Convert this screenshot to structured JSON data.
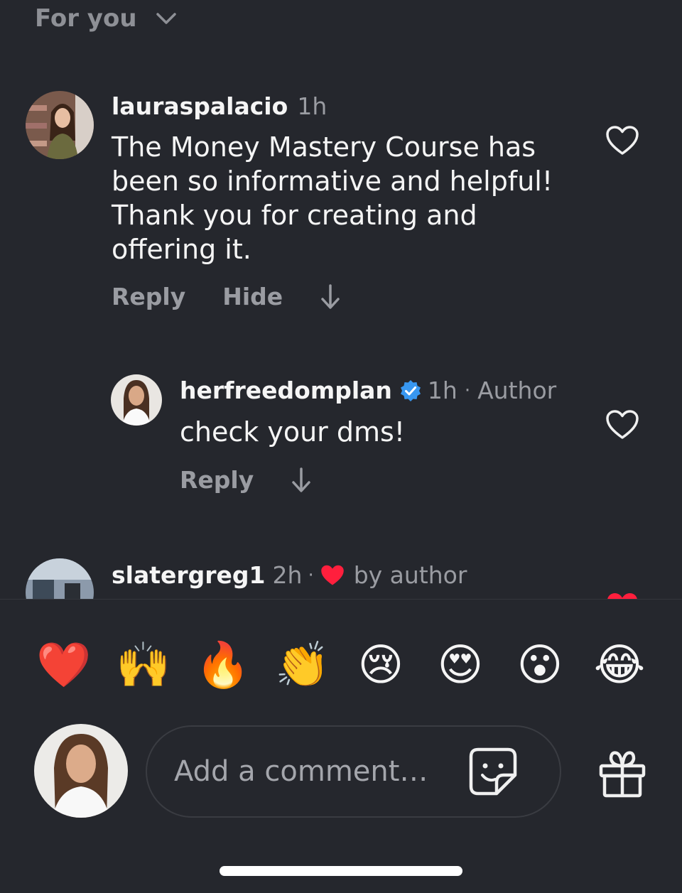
{
  "header": {
    "sort_label": "For you"
  },
  "comments": [
    {
      "username": "lauraspalacio",
      "time": "1h",
      "text": "The Money Mastery Course has been so informative and helpful! Thank you  for creating and offering it.",
      "reply_label": "Reply",
      "hide_label": "Hide"
    },
    {
      "username": "herfreedomplan",
      "verified": true,
      "time": "1h",
      "separator": "·",
      "author_label": "Author",
      "text": "check your dms!",
      "reply_label": "Reply"
    },
    {
      "username": "slatergreg1",
      "time": "2h",
      "separator": "·",
      "liked_by": "by author"
    }
  ],
  "reactions": [
    "❤️",
    "🙌",
    "🔥",
    "👏",
    "😢",
    "😍",
    "😮",
    "😂"
  ],
  "composer": {
    "placeholder": "Add a comment…"
  },
  "colors": {
    "background": "#25272d",
    "heart_red": "#ff1f3d",
    "verified_blue": "#3897f0"
  }
}
